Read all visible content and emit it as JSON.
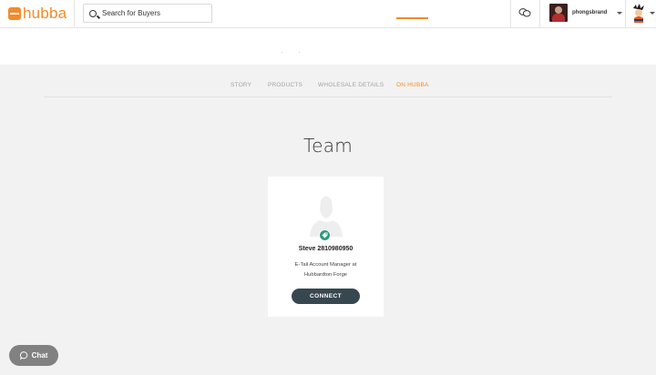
{
  "brand": {
    "name": "hubba",
    "color": "#f28b2a"
  },
  "search": {
    "placeholder": "Search for Buyers"
  },
  "user": {
    "name": "phongsbrand"
  },
  "tabs": [
    {
      "label": "STORY",
      "active": false
    },
    {
      "label": "PRODUCTS",
      "active": false
    },
    {
      "label": "WHOLESALE DETAILS",
      "active": false
    },
    {
      "label": "ON HUBBA",
      "active": true
    }
  ],
  "section": {
    "title": "Team"
  },
  "team": [
    {
      "name": "Steve 2810980950",
      "role_line1": "E-Tail Account Manager at",
      "role_line2": "Hubbardton Forge",
      "connect_label": "CONNECT",
      "badge_color": "#2e9b7e",
      "badge_icon": "tag-icon"
    }
  ],
  "chat": {
    "label": "Chat"
  }
}
